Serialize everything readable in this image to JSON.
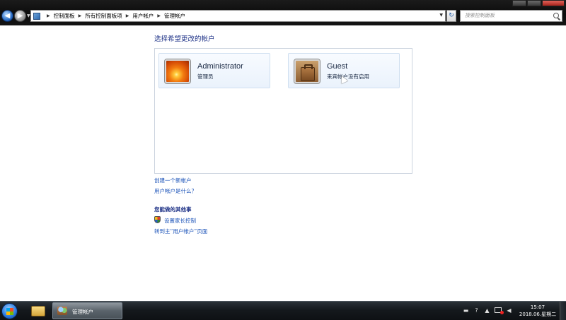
{
  "address_bar": {
    "breadcrumbs": [
      "控制面板",
      "所有控制面板项",
      "用户帐户",
      "管理帐户"
    ]
  },
  "search": {
    "placeholder": "搜索控制面板"
  },
  "main": {
    "heading": "选择希望更改的帐户",
    "accounts": [
      {
        "name": "Administrator",
        "description": "管理员"
      },
      {
        "name": "Guest",
        "description": "来宾帐户没有启用"
      }
    ],
    "links": {
      "create_account": "创建一个新帐户",
      "what_is_account": "用户帐户是什么？"
    },
    "other_section": {
      "title": "您能做的其他事",
      "parental_controls": "设置家长控制",
      "go_to_main": "转到主“用户帐户”页面"
    }
  },
  "taskbar": {
    "active_task": "管理帐户",
    "clock_time": "15:07",
    "clock_date": "2018.06.星期二"
  }
}
